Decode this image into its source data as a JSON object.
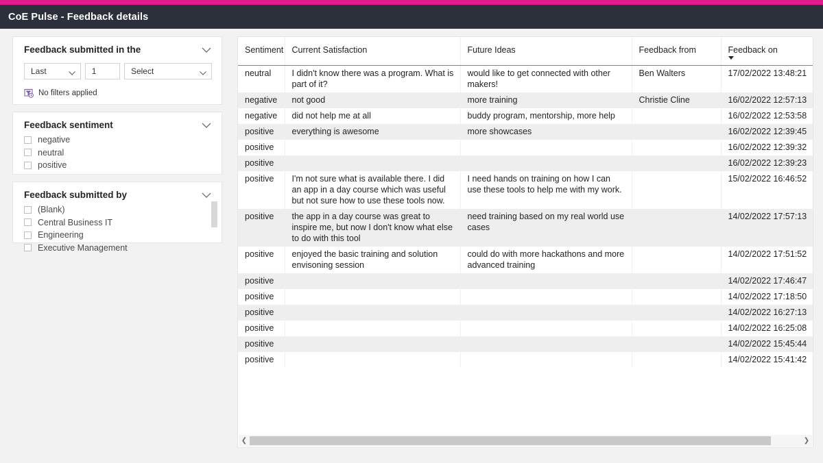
{
  "theme": {
    "accent": "#e31a8c",
    "titlebar_bg": "#2b303a",
    "header_underline": "#4a90c4",
    "row_alt_bg": "#eeeeee"
  },
  "titlebar": {
    "title": "CoE Pulse - Feedback details"
  },
  "filters": {
    "date_card": {
      "title": "Feedback submitted in the",
      "collapse_icon": "chevron-down-icon",
      "operator": {
        "value": "Last",
        "icon": "chevron-down-icon"
      },
      "count": {
        "value": "1"
      },
      "unit": {
        "value": "Select",
        "icon": "chevron-down-icon"
      },
      "status_icon": "filter-clock-icon",
      "status": "No filters applied"
    },
    "sentiment_card": {
      "title": "Feedback sentiment",
      "collapse_icon": "chevron-down-icon",
      "items": [
        {
          "label": "negative",
          "checked": false
        },
        {
          "label": "neutral",
          "checked": false
        },
        {
          "label": "positive",
          "checked": false
        }
      ]
    },
    "submitted_by_card": {
      "title": "Feedback submitted by",
      "collapse_icon": "chevron-down-icon",
      "items": [
        {
          "label": "(Blank)",
          "checked": false
        },
        {
          "label": "Central Business IT",
          "checked": false
        },
        {
          "label": "Engineering",
          "checked": false
        },
        {
          "label": "Executive Management",
          "checked": false
        }
      ]
    }
  },
  "table": {
    "columns": [
      {
        "key": "sentiment",
        "label": "Sentiment",
        "sorted": false
      },
      {
        "key": "current_satisfaction",
        "label": "Current Satisfaction",
        "sorted": false
      },
      {
        "key": "future_ideas",
        "label": "Future Ideas",
        "sorted": false
      },
      {
        "key": "feedback_from",
        "label": "Feedback from",
        "sorted": false
      },
      {
        "key": "feedback_on",
        "label": "Feedback on",
        "sorted": true,
        "sort_direction": "desc",
        "sort_icon": "caret-down-icon"
      }
    ],
    "rows": [
      {
        "sentiment": "neutral",
        "current_satisfaction": "I didn't know there was a program. What is part of it?",
        "future_ideas": "would like to get connected with other makers!",
        "feedback_from": "Ben Walters",
        "feedback_on": "17/02/2022 13:48:21"
      },
      {
        "sentiment": "negative",
        "current_satisfaction": "not good",
        "future_ideas": "more training",
        "feedback_from": "Christie Cline",
        "feedback_on": "16/02/2022 12:57:13"
      },
      {
        "sentiment": "negative",
        "current_satisfaction": "did not help me at all",
        "future_ideas": "buddy program, mentorship, more help",
        "feedback_from": "",
        "feedback_on": "16/02/2022 12:53:58"
      },
      {
        "sentiment": "positive",
        "current_satisfaction": "everything is awesome",
        "future_ideas": "more showcases",
        "feedback_from": "",
        "feedback_on": "16/02/2022 12:39:45"
      },
      {
        "sentiment": "positive",
        "current_satisfaction": "",
        "future_ideas": "",
        "feedback_from": "",
        "feedback_on": "16/02/2022 12:39:32"
      },
      {
        "sentiment": "positive",
        "current_satisfaction": "",
        "future_ideas": "",
        "feedback_from": "",
        "feedback_on": "16/02/2022 12:39:23"
      },
      {
        "sentiment": "positive",
        "current_satisfaction": "I'm not sure what is available there. I did an app in a day course which was useful but not sure how to use these tools now.",
        "future_ideas": "I need hands on training on how I can use these tools to help me with my work.",
        "feedback_from": "",
        "feedback_on": "15/02/2022 16:46:52"
      },
      {
        "sentiment": "positive",
        "current_satisfaction": "the app in a day course was great to inspire me, but now I don't know what else to do with this tool",
        "future_ideas": "need training based on my real world use cases",
        "feedback_from": "",
        "feedback_on": "14/02/2022 17:57:13"
      },
      {
        "sentiment": "positive",
        "current_satisfaction": "enjoyed the basic training and solution envisoning session",
        "future_ideas": "could do with more hackathons and more advanced training",
        "feedback_from": "",
        "feedback_on": "14/02/2022 17:51:52"
      },
      {
        "sentiment": "positive",
        "current_satisfaction": "",
        "future_ideas": "",
        "feedback_from": "",
        "feedback_on": "14/02/2022 17:46:47"
      },
      {
        "sentiment": "positive",
        "current_satisfaction": "",
        "future_ideas": "",
        "feedback_from": "",
        "feedback_on": "14/02/2022 17:18:50"
      },
      {
        "sentiment": "positive",
        "current_satisfaction": "",
        "future_ideas": "",
        "feedback_from": "",
        "feedback_on": "14/02/2022 16:27:13"
      },
      {
        "sentiment": "positive",
        "current_satisfaction": "",
        "future_ideas": "",
        "feedback_from": "",
        "feedback_on": "14/02/2022 16:25:08"
      },
      {
        "sentiment": "positive",
        "current_satisfaction": "",
        "future_ideas": "",
        "feedback_from": "",
        "feedback_on": "14/02/2022 15:45:44"
      },
      {
        "sentiment": "positive",
        "current_satisfaction": "",
        "future_ideas": "",
        "feedback_from": "",
        "feedback_on": "14/02/2022 15:41:42"
      }
    ],
    "hscroll": {
      "left_icon": "chevron-left-icon",
      "right_icon": "chevron-right-icon"
    }
  }
}
